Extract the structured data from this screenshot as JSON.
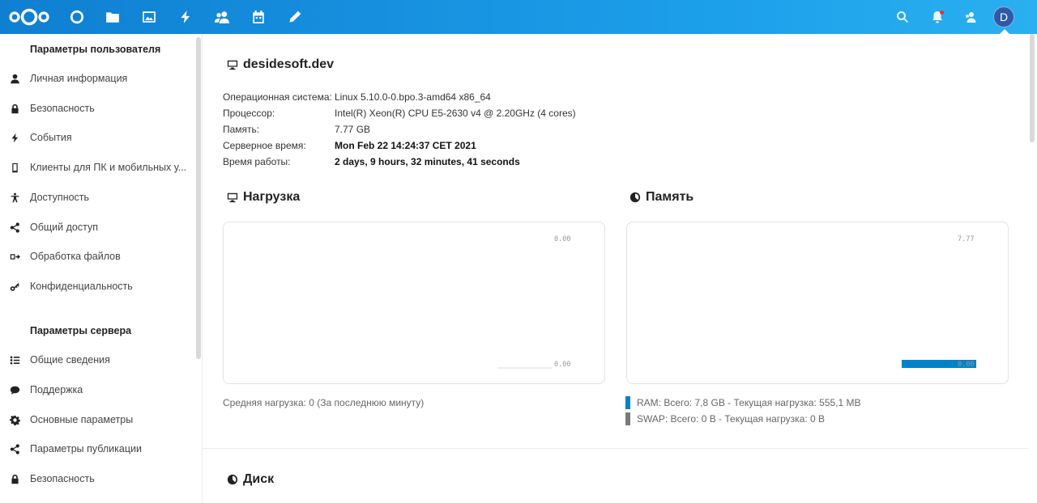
{
  "colors": {
    "brand": "#0f7fd1",
    "ram": "#0082c9",
    "swap": "#7a7a7a"
  },
  "header": {
    "apps": [
      {
        "name": "dashboard-icon"
      },
      {
        "name": "files-icon"
      },
      {
        "name": "photos-icon"
      },
      {
        "name": "activity-icon"
      },
      {
        "name": "contacts-icon"
      },
      {
        "name": "calendar-icon"
      },
      {
        "name": "notes-icon"
      }
    ],
    "avatar_letter": "D"
  },
  "sidebar": {
    "personal_title": "Параметры пользователя",
    "personal_items": [
      {
        "label": "Личная информация",
        "icon": "user-icon"
      },
      {
        "label": "Безопасность",
        "icon": "lock-icon"
      },
      {
        "label": "События",
        "icon": "lightning-icon"
      },
      {
        "label": "Клиенты для ПК и мобильных у...",
        "icon": "phone-icon"
      },
      {
        "label": "Доступность",
        "icon": "accessibility-icon"
      },
      {
        "label": "Общий доступ",
        "icon": "share-icon"
      },
      {
        "label": "Обработка файлов",
        "icon": "workflow-icon"
      },
      {
        "label": "Конфиденциальность",
        "icon": "key-icon"
      }
    ],
    "server_title": "Параметры сервера",
    "server_items": [
      {
        "label": "Общие сведения",
        "icon": "list-icon"
      },
      {
        "label": "Поддержка",
        "icon": "chat-icon"
      },
      {
        "label": "Основные параметры",
        "icon": "gear-icon"
      },
      {
        "label": "Параметры публикации",
        "icon": "share-icon"
      },
      {
        "label": "Безопасность",
        "icon": "lock-icon"
      }
    ]
  },
  "main": {
    "server_name": "desidesoft.dev",
    "info": [
      {
        "key": "Операционная система:",
        "value": "Linux 5.10.0-0.bpo.3-amd64 x86_64",
        "bold": false
      },
      {
        "key": "Процессор:",
        "value": "Intel(R) Xeon(R) CPU E5-2630 v4 @ 2.20GHz (4 cores)",
        "bold": false
      },
      {
        "key": "Память:",
        "value": "7.77 GB",
        "bold": false
      },
      {
        "key": "Серверное время:",
        "value": "Mon Feb 22 14:24:37 CET 2021",
        "bold": true
      },
      {
        "key": "Время работы:",
        "value": "2 days, 9 hours, 32 minutes, 41 seconds",
        "bold": true
      }
    ],
    "load": {
      "title": "Нагрузка",
      "tick_top": "0.00",
      "tick_bottom": "0.00",
      "caption": "Средняя нагрузка: 0 (За последнюю минуту)"
    },
    "memory": {
      "title": "Память",
      "tick_top": "7.77",
      "tick_bottom": "0.00",
      "ram_legend": "RAM: Всего: 7,8 GB - Текущая нагрузка: 555,1 MB",
      "swap_legend": "SWAP: Всего: 0 B - Текущая нагрузка: 0 B"
    },
    "disk_title": "Диск"
  },
  "chart_data": [
    {
      "type": "line",
      "title": "Нагрузка",
      "ylim": [
        0,
        0
      ],
      "series": [
        {
          "values": [
            0
          ]
        }
      ]
    },
    {
      "type": "bar",
      "title": "Память",
      "ylim": [
        0,
        7.77
      ],
      "series": [
        {
          "name": "RAM",
          "values": [
            0.5551
          ]
        },
        {
          "name": "SWAP",
          "values": [
            0
          ]
        }
      ]
    }
  ]
}
